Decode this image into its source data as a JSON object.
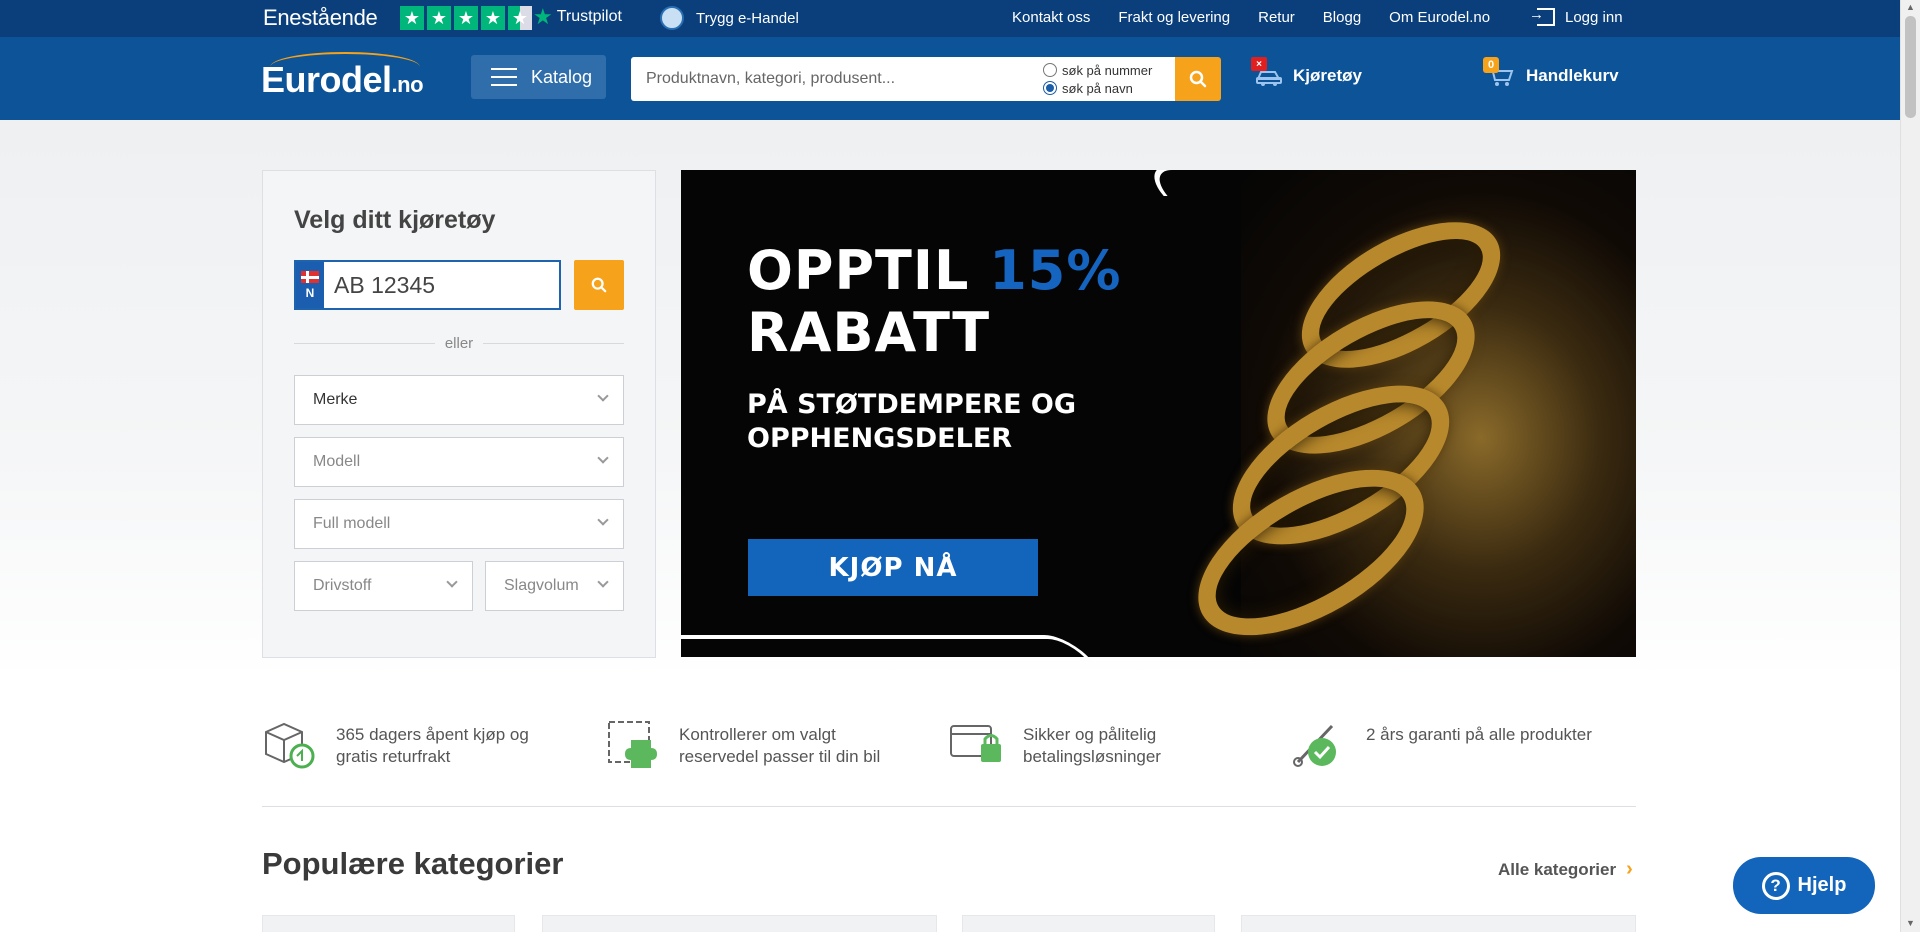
{
  "topbar": {
    "rating_label": "Enestående",
    "trustpilot": "Trustpilot",
    "trygg": "Trygg e-Handel",
    "links": [
      "Kontakt oss",
      "Frakt og levering",
      "Retur",
      "Blogg",
      "Om Eurodel.no"
    ],
    "login": "Logg inn"
  },
  "header": {
    "logo_main": "Eurodel",
    "logo_tld": ".no",
    "katalog": "Katalog",
    "search_placeholder": "Produktnavn, kategori, produsent...",
    "radio_number": "søk på nummer",
    "radio_name": "søk på navn",
    "vehicle": "Kjøretøy",
    "vehicle_badge": "×",
    "cart": "Handlekurv",
    "cart_count": "0"
  },
  "selector": {
    "title": "Velg ditt kjøretøy",
    "plate_placeholder": "AB 12345",
    "plate_country": "N",
    "or": "eller",
    "merke": "Merke",
    "modell": "Modell",
    "full_modell": "Full modell",
    "drivstoff": "Drivstoff",
    "slagvolum": "Slagvolum"
  },
  "banner": {
    "line1_a": "OPPTIL ",
    "line1_b": "15%",
    "line2": "RABATT",
    "sub1": "PÅ STØTDEMPERE OG",
    "sub2": "OPPHENGSDELER",
    "cta": "KJØP NÅ"
  },
  "features": [
    {
      "icon": "box-return-icon",
      "l1": "365 dagers åpent kjøp og",
      "l2": "gratis returfrakt"
    },
    {
      "icon": "puzzle-car-icon",
      "l1": "Kontrollerer om valgt",
      "l2": "reservedel passer til din bil"
    },
    {
      "icon": "secure-card-icon",
      "l1": "Sikker og pålitelig",
      "l2": "betalingsløsninger"
    },
    {
      "icon": "warranty-tool-icon",
      "l1": "2 års garanti på alle produkter",
      "l2": ""
    }
  ],
  "categories": {
    "title": "Populære kategorier",
    "all": "Alle kategorier"
  },
  "help": {
    "label": "Hjelp"
  },
  "colors": {
    "topbar": "#0a3f7c",
    "header": "#0c5398",
    "accent": "#f7a21b",
    "cta": "#1265bb"
  }
}
